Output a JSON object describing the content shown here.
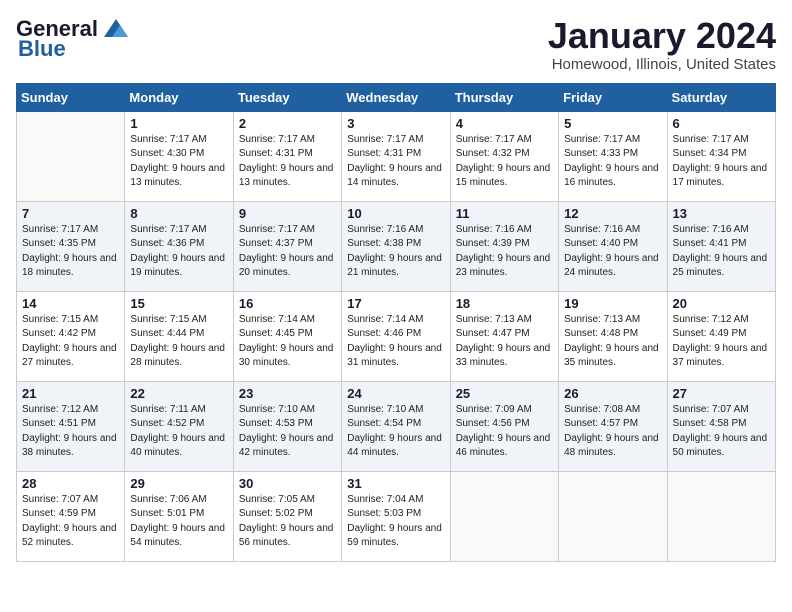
{
  "logo": {
    "line1": "General",
    "line2": "Blue"
  },
  "title": "January 2024",
  "subtitle": "Homewood, Illinois, United States",
  "weekdays": [
    "Sunday",
    "Monday",
    "Tuesday",
    "Wednesday",
    "Thursday",
    "Friday",
    "Saturday"
  ],
  "weeks": [
    [
      {
        "day": "",
        "sunrise": "",
        "sunset": "",
        "daylight": ""
      },
      {
        "day": "1",
        "sunrise": "Sunrise: 7:17 AM",
        "sunset": "Sunset: 4:30 PM",
        "daylight": "Daylight: 9 hours and 13 minutes."
      },
      {
        "day": "2",
        "sunrise": "Sunrise: 7:17 AM",
        "sunset": "Sunset: 4:31 PM",
        "daylight": "Daylight: 9 hours and 13 minutes."
      },
      {
        "day": "3",
        "sunrise": "Sunrise: 7:17 AM",
        "sunset": "Sunset: 4:31 PM",
        "daylight": "Daylight: 9 hours and 14 minutes."
      },
      {
        "day": "4",
        "sunrise": "Sunrise: 7:17 AM",
        "sunset": "Sunset: 4:32 PM",
        "daylight": "Daylight: 9 hours and 15 minutes."
      },
      {
        "day": "5",
        "sunrise": "Sunrise: 7:17 AM",
        "sunset": "Sunset: 4:33 PM",
        "daylight": "Daylight: 9 hours and 16 minutes."
      },
      {
        "day": "6",
        "sunrise": "Sunrise: 7:17 AM",
        "sunset": "Sunset: 4:34 PM",
        "daylight": "Daylight: 9 hours and 17 minutes."
      }
    ],
    [
      {
        "day": "7",
        "sunrise": "Sunrise: 7:17 AM",
        "sunset": "Sunset: 4:35 PM",
        "daylight": "Daylight: 9 hours and 18 minutes."
      },
      {
        "day": "8",
        "sunrise": "Sunrise: 7:17 AM",
        "sunset": "Sunset: 4:36 PM",
        "daylight": "Daylight: 9 hours and 19 minutes."
      },
      {
        "day": "9",
        "sunrise": "Sunrise: 7:17 AM",
        "sunset": "Sunset: 4:37 PM",
        "daylight": "Daylight: 9 hours and 20 minutes."
      },
      {
        "day": "10",
        "sunrise": "Sunrise: 7:16 AM",
        "sunset": "Sunset: 4:38 PM",
        "daylight": "Daylight: 9 hours and 21 minutes."
      },
      {
        "day": "11",
        "sunrise": "Sunrise: 7:16 AM",
        "sunset": "Sunset: 4:39 PM",
        "daylight": "Daylight: 9 hours and 23 minutes."
      },
      {
        "day": "12",
        "sunrise": "Sunrise: 7:16 AM",
        "sunset": "Sunset: 4:40 PM",
        "daylight": "Daylight: 9 hours and 24 minutes."
      },
      {
        "day": "13",
        "sunrise": "Sunrise: 7:16 AM",
        "sunset": "Sunset: 4:41 PM",
        "daylight": "Daylight: 9 hours and 25 minutes."
      }
    ],
    [
      {
        "day": "14",
        "sunrise": "Sunrise: 7:15 AM",
        "sunset": "Sunset: 4:42 PM",
        "daylight": "Daylight: 9 hours and 27 minutes."
      },
      {
        "day": "15",
        "sunrise": "Sunrise: 7:15 AM",
        "sunset": "Sunset: 4:44 PM",
        "daylight": "Daylight: 9 hours and 28 minutes."
      },
      {
        "day": "16",
        "sunrise": "Sunrise: 7:14 AM",
        "sunset": "Sunset: 4:45 PM",
        "daylight": "Daylight: 9 hours and 30 minutes."
      },
      {
        "day": "17",
        "sunrise": "Sunrise: 7:14 AM",
        "sunset": "Sunset: 4:46 PM",
        "daylight": "Daylight: 9 hours and 31 minutes."
      },
      {
        "day": "18",
        "sunrise": "Sunrise: 7:13 AM",
        "sunset": "Sunset: 4:47 PM",
        "daylight": "Daylight: 9 hours and 33 minutes."
      },
      {
        "day": "19",
        "sunrise": "Sunrise: 7:13 AM",
        "sunset": "Sunset: 4:48 PM",
        "daylight": "Daylight: 9 hours and 35 minutes."
      },
      {
        "day": "20",
        "sunrise": "Sunrise: 7:12 AM",
        "sunset": "Sunset: 4:49 PM",
        "daylight": "Daylight: 9 hours and 37 minutes."
      }
    ],
    [
      {
        "day": "21",
        "sunrise": "Sunrise: 7:12 AM",
        "sunset": "Sunset: 4:51 PM",
        "daylight": "Daylight: 9 hours and 38 minutes."
      },
      {
        "day": "22",
        "sunrise": "Sunrise: 7:11 AM",
        "sunset": "Sunset: 4:52 PM",
        "daylight": "Daylight: 9 hours and 40 minutes."
      },
      {
        "day": "23",
        "sunrise": "Sunrise: 7:10 AM",
        "sunset": "Sunset: 4:53 PM",
        "daylight": "Daylight: 9 hours and 42 minutes."
      },
      {
        "day": "24",
        "sunrise": "Sunrise: 7:10 AM",
        "sunset": "Sunset: 4:54 PM",
        "daylight": "Daylight: 9 hours and 44 minutes."
      },
      {
        "day": "25",
        "sunrise": "Sunrise: 7:09 AM",
        "sunset": "Sunset: 4:56 PM",
        "daylight": "Daylight: 9 hours and 46 minutes."
      },
      {
        "day": "26",
        "sunrise": "Sunrise: 7:08 AM",
        "sunset": "Sunset: 4:57 PM",
        "daylight": "Daylight: 9 hours and 48 minutes."
      },
      {
        "day": "27",
        "sunrise": "Sunrise: 7:07 AM",
        "sunset": "Sunset: 4:58 PM",
        "daylight": "Daylight: 9 hours and 50 minutes."
      }
    ],
    [
      {
        "day": "28",
        "sunrise": "Sunrise: 7:07 AM",
        "sunset": "Sunset: 4:59 PM",
        "daylight": "Daylight: 9 hours and 52 minutes."
      },
      {
        "day": "29",
        "sunrise": "Sunrise: 7:06 AM",
        "sunset": "Sunset: 5:01 PM",
        "daylight": "Daylight: 9 hours and 54 minutes."
      },
      {
        "day": "30",
        "sunrise": "Sunrise: 7:05 AM",
        "sunset": "Sunset: 5:02 PM",
        "daylight": "Daylight: 9 hours and 56 minutes."
      },
      {
        "day": "31",
        "sunrise": "Sunrise: 7:04 AM",
        "sunset": "Sunset: 5:03 PM",
        "daylight": "Daylight: 9 hours and 59 minutes."
      },
      {
        "day": "",
        "sunrise": "",
        "sunset": "",
        "daylight": ""
      },
      {
        "day": "",
        "sunrise": "",
        "sunset": "",
        "daylight": ""
      },
      {
        "day": "",
        "sunrise": "",
        "sunset": "",
        "daylight": ""
      }
    ]
  ]
}
